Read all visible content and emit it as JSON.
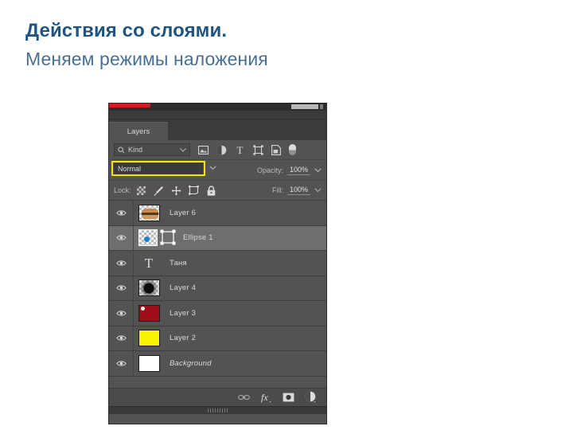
{
  "slide": {
    "title_line1": "Действия со слоями.",
    "title_line2": "Меняем режимы наложения",
    "title_color_bold": "#1f5582",
    "title_color_regular": "#486f96"
  },
  "panel": {
    "tab_label": "Layers",
    "accent_red": "#cc1f1f",
    "highlight_color": "#f5e400",
    "filter": {
      "kind_label": "Kind",
      "search_icon": "search-icon",
      "type_icons": [
        "image-filter-icon",
        "adjustment-filter-icon",
        "type-filter-icon",
        "shape-filter-icon",
        "smart-object-filter-icon"
      ],
      "toggle_icon": "filter-toggle-switch"
    },
    "blend": {
      "mode": "Normal",
      "opacity_label": "Opacity:",
      "opacity_value": "100%"
    },
    "lock": {
      "label": "Lock:",
      "icons": [
        "lock-transparent-pixels-icon",
        "lock-image-pixels-icon",
        "lock-position-icon",
        "lock-artboard-icon",
        "lock-all-icon"
      ],
      "fill_label": "Fill:",
      "fill_value": "100%"
    },
    "layers": [
      {
        "name": "Layer 6",
        "thumb": "burger-image",
        "selected": false,
        "italic": false,
        "visible": true,
        "kind": "raster"
      },
      {
        "name": "Ellipse 1",
        "thumb": "blue-dot-shape",
        "selected": true,
        "italic": false,
        "visible": true,
        "kind": "shape"
      },
      {
        "name": "Таня",
        "thumb": "type-T-glyph",
        "selected": false,
        "italic": false,
        "visible": true,
        "kind": "type"
      },
      {
        "name": "Layer 4",
        "thumb": "black-blur-circle",
        "selected": false,
        "italic": false,
        "visible": true,
        "kind": "raster"
      },
      {
        "name": "Layer 3",
        "thumb": "red-fill",
        "selected": false,
        "italic": false,
        "visible": true,
        "kind": "raster"
      },
      {
        "name": "Layer 2",
        "thumb": "yellow-fill",
        "selected": false,
        "italic": false,
        "visible": true,
        "kind": "raster"
      },
      {
        "name": "Background",
        "thumb": "white-fill",
        "selected": false,
        "italic": true,
        "visible": true,
        "kind": "background"
      }
    ],
    "footer_buttons": [
      "link-layers-icon",
      "layer-style-fx-icon",
      "add-layer-mask-icon",
      "new-adjustment-layer-icon"
    ]
  }
}
